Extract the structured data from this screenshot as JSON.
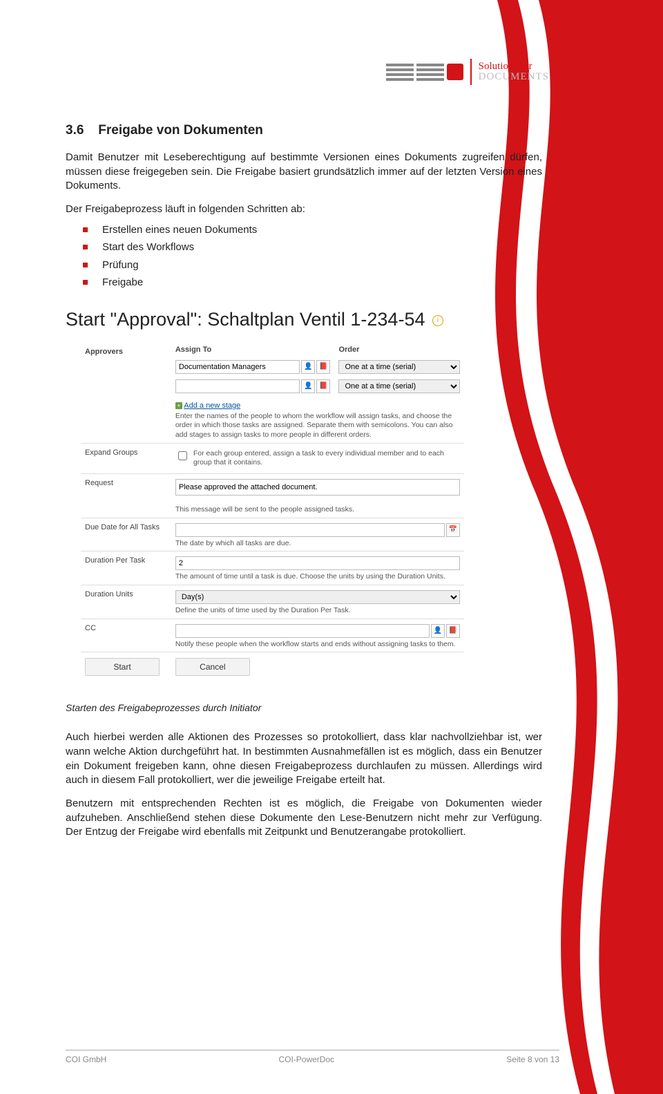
{
  "logo": {
    "slogan_l1": "Solutions for",
    "slogan_l2": "DOCUMENTS"
  },
  "section": {
    "number": "3.6",
    "title": "Freigabe von Dokumenten"
  },
  "para1": "Damit Benutzer mit Leseberechtigung auf bestimmte Versionen eines Dokuments zugreifen dürfen, müssen diese freigegeben sein. Die Freigabe basiert grundsätzlich immer auf der letzten Version eines Dokuments.",
  "para_listintro": "Der Freigabeprozess läuft in folgenden Schritten ab:",
  "bullets": [
    "Erstellen eines neuen Dokuments",
    "Start des Workflows",
    "Prüfung",
    "Freigabe"
  ],
  "dialog_title": "Start \"Approval\": Schaltplan Ventil 1-234-54",
  "form": {
    "approvers_label": "Approvers",
    "assign_to_header": "Assign To",
    "order_header": "Order",
    "assign_value1": "Documentation Managers",
    "order_value": "One at a time (serial)",
    "add_stage_link": "Add a new stage",
    "approvers_hint": "Enter the names of the people to whom the workflow will assign tasks, and choose the order in which those tasks are assigned. Separate them with semicolons. You can also add stages to assign tasks to more people in different orders.",
    "expand_label": "Expand Groups",
    "expand_hint": "For each group entered, assign a task to every individual member and to each group that it contains.",
    "request_label": "Request",
    "request_value": "Please approved the attached document.",
    "request_hint": "This message will be sent to the people assigned tasks.",
    "due_label": "Due Date for All Tasks",
    "due_hint": "The date by which all tasks are due.",
    "duration_label": "Duration Per Task",
    "duration_value": "2",
    "duration_hint": "The amount of time until a task is due. Choose the units by using the Duration Units.",
    "units_label": "Duration Units",
    "units_value": "Day(s)",
    "units_hint": "Define the units of time used by the Duration Per Task.",
    "cc_label": "CC",
    "cc_hint": "Notify these people when the workflow starts and ends without assigning tasks to them.",
    "btn_start": "Start",
    "btn_cancel": "Cancel"
  },
  "caption": "Starten des Freigabeprozesses durch Initiator",
  "para2": "Auch hierbei werden alle Aktionen des Prozesses so protokolliert, dass klar nachvollziehbar ist, wer wann welche Aktion durchgeführt hat. In bestimmten Ausnahmefällen ist es möglich, dass ein Benutzer ein Dokument freigeben kann, ohne diesen Freigabeprozess durchlaufen zu müssen. Allerdings wird auch in diesem Fall protokolliert, wer die jeweilige Freigabe erteilt hat.",
  "para3": "Benutzern mit entsprechenden Rechten ist es möglich, die Freigabe von Dokumenten wieder aufzuheben. Anschließend stehen diese Dokumente den Lese-Benutzern nicht mehr zur Verfügung. Der Entzug der Freigabe wird ebenfalls mit Zeitpunkt und Benutzerangabe protokolliert.",
  "footer": {
    "left": "COI GmbH",
    "center": "COI-PowerDoc",
    "right_pre": "Seite ",
    "page": "8",
    "right_mid": " von ",
    "total": "13"
  }
}
